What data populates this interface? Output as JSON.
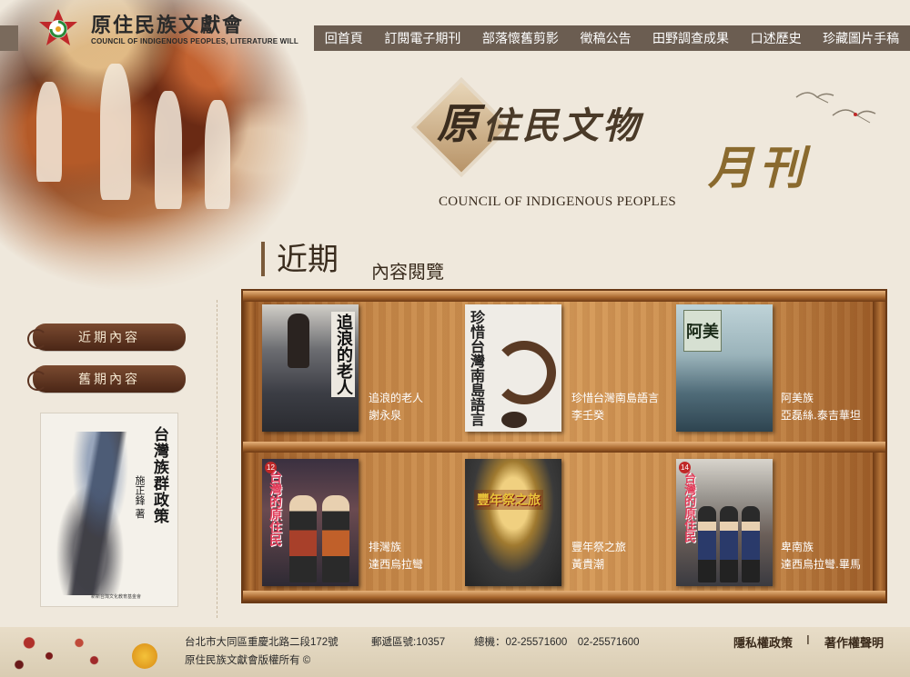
{
  "logo": {
    "title": "原住民族文獻會",
    "subtitle": "COUNCIL OF INDIGENOUS PEOPLES, LITERATURE WILL"
  },
  "nav": [
    {
      "label": "回首頁"
    },
    {
      "label": "訂閱電子期刊"
    },
    {
      "label": "部落懷舊剪影"
    },
    {
      "label": "徵稿公告"
    },
    {
      "label": "田野調查成果"
    },
    {
      "label": "口述歷史"
    },
    {
      "label": "珍藏圖片手稿"
    }
  ],
  "masthead": {
    "title_big": "原",
    "title_rest": "住民文物",
    "title_monthly": "月刊",
    "title_en": "COUNCIL OF INDIGENOUS PEOPLES"
  },
  "section": {
    "title": "近期",
    "subtitle": "內容閱覽"
  },
  "sidebar": {
    "buttons": [
      {
        "label": "近期內容"
      },
      {
        "label": "舊期內容"
      }
    ],
    "featured_book": {
      "title": "台灣族群政策",
      "author": "施正鋒 著",
      "publisher": "新新台灣文化教育基金會"
    }
  },
  "books": [
    {
      "title": "追浪的老人",
      "author": "謝永泉",
      "cover_text": "追浪的老人"
    },
    {
      "title": "珍惜台灣南島語言",
      "author": "李壬癸",
      "cover_text": "珍惜台灣南島語言"
    },
    {
      "title": "阿美族",
      "author": "亞磊絲.泰吉華坦",
      "cover_text": "阿美"
    },
    {
      "title": "排灣族",
      "author": "達西烏拉彎",
      "cover_text": "台灣的原住民",
      "badge": "12"
    },
    {
      "title": "豐年祭之旅",
      "author": "黃貴潮",
      "cover_text": "豐年祭之旅"
    },
    {
      "title": "卑南族",
      "author": "達西烏拉彎.畢馬",
      "cover_text": "台灣的原住民",
      "badge": "14"
    }
  ],
  "footer": {
    "address": "台北市大同區重慶北路二段172號",
    "zip": "郵遞區號:10357",
    "phone": "總機：02-25571600　02-25571600",
    "copyright": "原住民族文獻會版權所有 ©",
    "privacy": "隱私權政策",
    "separator": "I",
    "copyright_notice": "著作權聲明"
  }
}
